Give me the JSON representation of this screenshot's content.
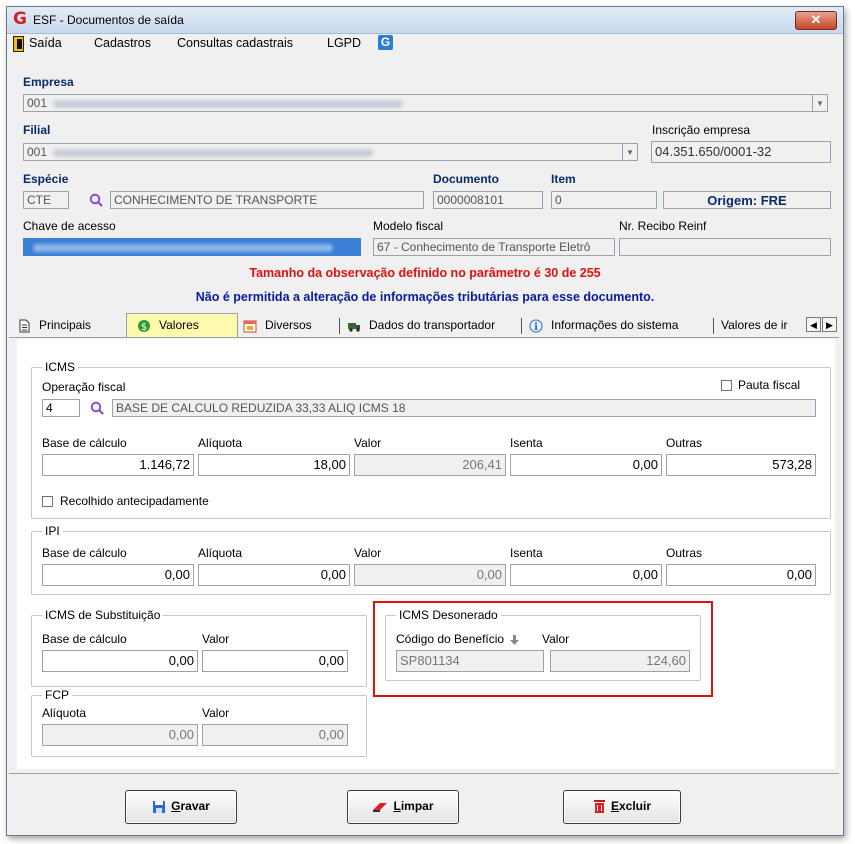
{
  "window": {
    "title": "ESF - Documentos de saída",
    "close_label": "✕"
  },
  "menu": {
    "items": [
      "Saída",
      "Cadastros",
      "Consultas cadastrais",
      "LGPD"
    ]
  },
  "empresa": {
    "label": "Empresa",
    "code": "001"
  },
  "filial": {
    "label": "Filial",
    "code": "001"
  },
  "inscricao": {
    "label": "Inscrição empresa",
    "value": "04.351.650/0001-32"
  },
  "especie": {
    "label": "Espécie",
    "code": "CTE",
    "description": "CONHECIMENTO DE TRANSPORTE"
  },
  "documento": {
    "label": "Documento",
    "value": "0000008101"
  },
  "item": {
    "label": "Item",
    "value": "0"
  },
  "origem": {
    "label": "Origem: FRE"
  },
  "chave": {
    "label": "Chave de acesso"
  },
  "modelo": {
    "label": "Modelo fiscal",
    "value": "67 - Conhecimento de Transporte Eletrô"
  },
  "recibo": {
    "label": "Nr. Recibo Reinf",
    "value": ""
  },
  "warnings": {
    "obs": "Tamanho da observação definido no parâmetro é 30 de 255",
    "trib": "Não é permitida a alteração de informações tributárias para esse documento."
  },
  "colors": {
    "warn_red": "#e01010",
    "warn_blue": "#0a1a9a",
    "active_tab": "#fff9b0"
  },
  "tabs": [
    "Principais",
    "Valores",
    "Diversos",
    "Dados do transportador",
    "Informações do sistema",
    "Valores de ir"
  ],
  "icms": {
    "title": "ICMS",
    "operacao_label": "Operação fiscal",
    "operacao_code": "4",
    "operacao_desc": "BASE DE CALCULO REDUZIDA  33,33  ALIQ ICMS 18",
    "pauta_label": "Pauta fiscal",
    "labels": [
      "Base de cálculo",
      "Alíquota",
      "Valor",
      "Isenta",
      "Outras"
    ],
    "values": [
      "1.146,72",
      "18,00",
      "206,41",
      "0,00",
      "573,28"
    ],
    "recolhido_label": "Recolhido antecipadamente"
  },
  "ipi": {
    "title": "IPI",
    "labels": [
      "Base de cálculo",
      "Alíquota",
      "Valor",
      "Isenta",
      "Outras"
    ],
    "values": [
      "0,00",
      "0,00",
      "0,00",
      "0,00",
      "0,00"
    ]
  },
  "icms_st": {
    "title": "ICMS de Substituição",
    "base_label": "Base de cálculo",
    "valor_label": "Valor",
    "base": "0,00",
    "valor": "0,00"
  },
  "fcp": {
    "title": "FCP",
    "aliq_label": "Alíquota",
    "valor_label": "Valor",
    "aliq": "0,00",
    "valor": "0,00"
  },
  "desonerado": {
    "title": "ICMS Desonerado",
    "codigo_label": "Código do Benefício",
    "valor_label": "Valor",
    "codigo": "SP801134",
    "valor": "124,60"
  },
  "buttons": {
    "gravar": {
      "first": "G",
      "rest": "ravar"
    },
    "limpar": {
      "first": "L",
      "rest": "impar"
    },
    "excluir": {
      "first": "E",
      "rest": "xcluir"
    }
  }
}
